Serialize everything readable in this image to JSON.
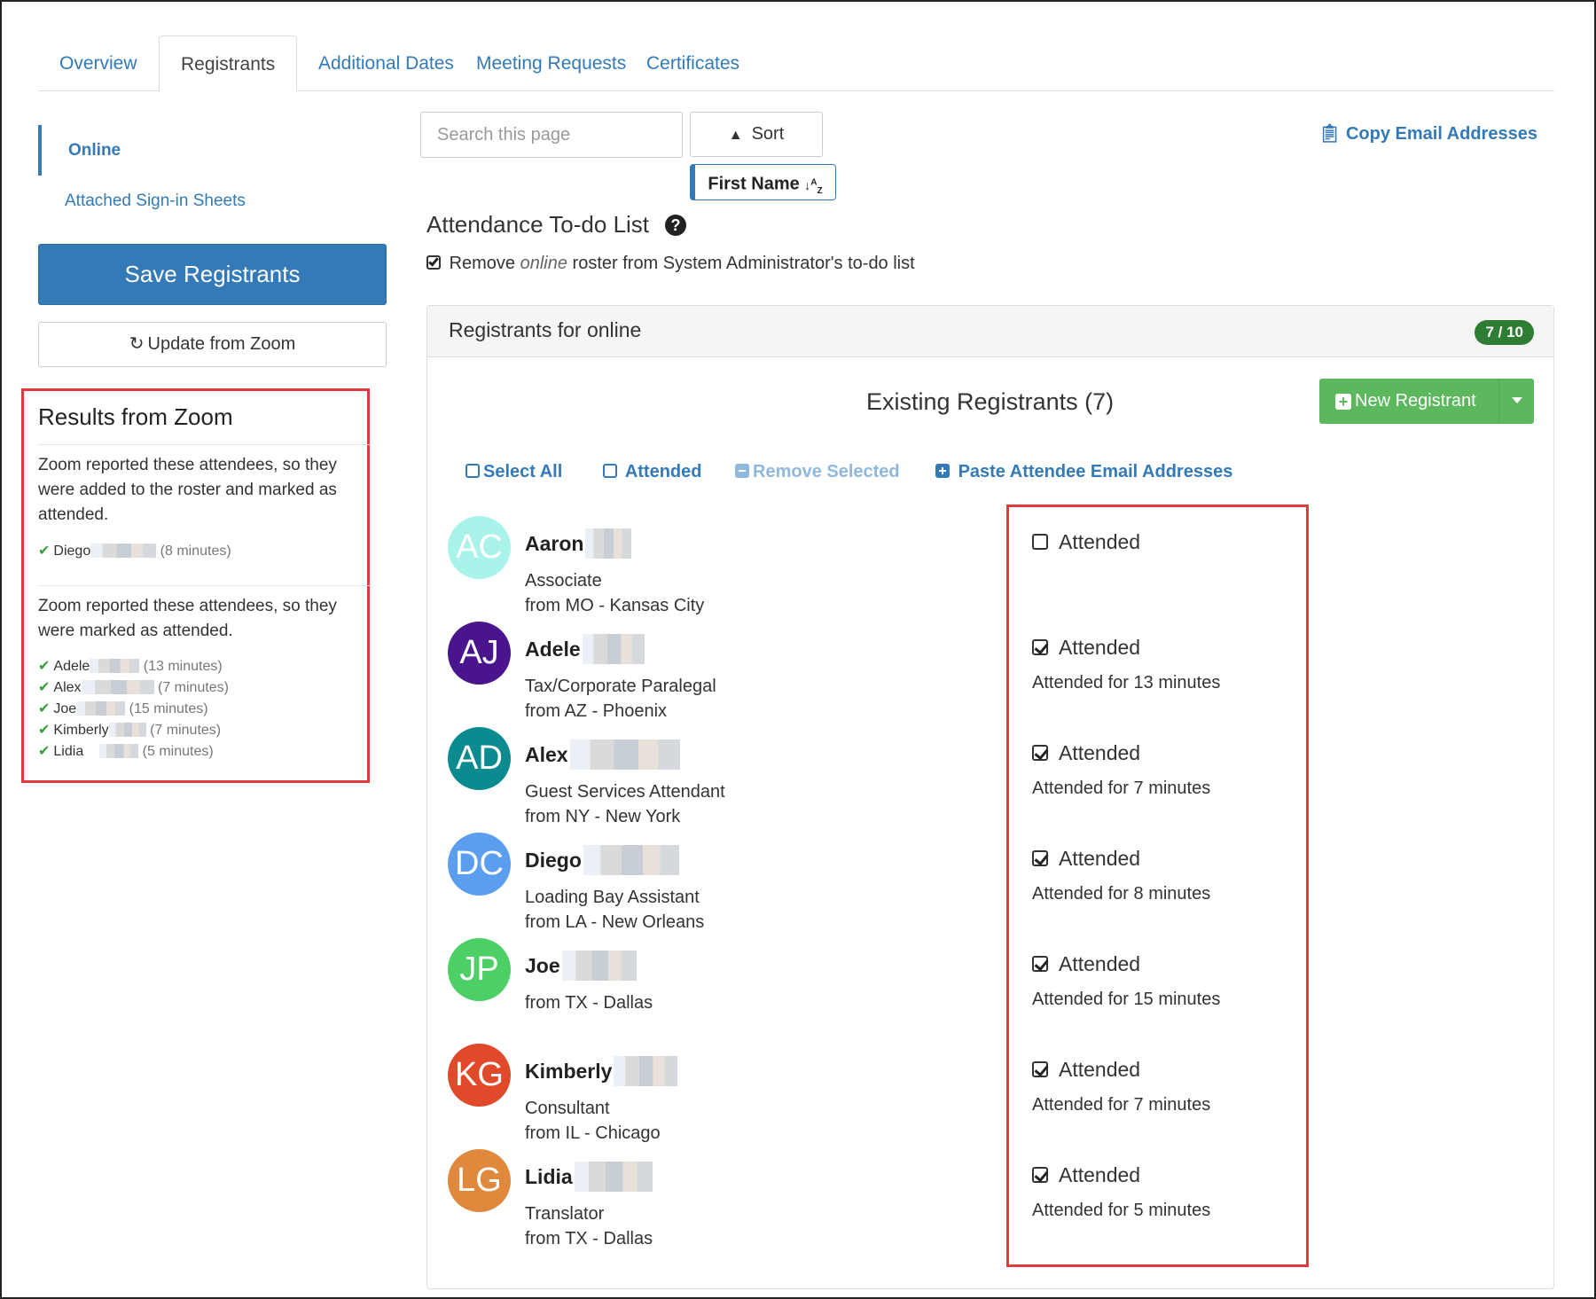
{
  "tabs": [
    {
      "label": "Overview",
      "active": false
    },
    {
      "label": "Registrants",
      "active": true
    },
    {
      "label": "Additional Dates",
      "active": false
    },
    {
      "label": "Meeting Requests",
      "active": false
    },
    {
      "label": "Certificates",
      "active": false
    }
  ],
  "sidebar": {
    "online": "Online",
    "sheets": "Attached Sign-in Sheets",
    "save_label": "Save Registrants",
    "zoom_label": "Update from Zoom"
  },
  "zoom_results": {
    "title": "Results from Zoom",
    "added_text": "Zoom reported these attendees, so they were added to the roster and marked as attended.",
    "added": [
      {
        "name": "Diego",
        "minutes": "(8 minutes)"
      }
    ],
    "marked_text": "Zoom reported these attendees, so they were marked as attended.",
    "marked": [
      {
        "name": "Adele",
        "minutes": "(13 minutes)"
      },
      {
        "name": "Alex",
        "minutes": "(7 minutes)"
      },
      {
        "name": "Joe",
        "minutes": "(15 minutes)"
      },
      {
        "name": "Kimberly",
        "minutes": "(7 minutes)"
      },
      {
        "name": "Lidia",
        "minutes": "(5 minutes)"
      }
    ]
  },
  "toolbar": {
    "search_placeholder": "Search this page",
    "sort_label": "Sort",
    "first_name_label": "First Name",
    "copy_email_label": "Copy Email Addresses"
  },
  "todo": {
    "title": "Attendance To-do List",
    "line_before": "Remove ",
    "line_em": "online",
    "line_after": " roster from System Administrator's to-do list"
  },
  "panel": {
    "title": "Registrants for online",
    "badge": "7 / 10",
    "existing_title": "Existing Registrants (7)",
    "new_label": "New Registrant",
    "actions": {
      "select_all": "Select All",
      "attended": "Attended",
      "remove_selected": "Remove Selected",
      "paste_emails": "Paste Attendee Email Addresses"
    }
  },
  "registrants": [
    {
      "initials": "AC",
      "color": "#a9f3ea",
      "name": "Aaron",
      "title": "Associate",
      "location": "from MO - Kansas City",
      "attended": false,
      "attended_label": "Attended",
      "duration": ""
    },
    {
      "initials": "AJ",
      "color": "#4a148c",
      "name": "Adele",
      "title": "Tax/Corporate Paralegal",
      "location": "from AZ - Phoenix",
      "attended": true,
      "attended_label": "Attended",
      "duration": "Attended for 13 minutes"
    },
    {
      "initials": "AD",
      "color": "#0b8a8f",
      "name": "Alex",
      "title": "Guest Services Attendant",
      "location": "from NY - New York",
      "attended": true,
      "attended_label": "Attended",
      "duration": "Attended for 7 minutes"
    },
    {
      "initials": "DC",
      "color": "#5b9ef0",
      "name": "Diego",
      "title": "Loading Bay Assistant",
      "location": "from LA - New Orleans",
      "attended": true,
      "attended_label": "Attended",
      "duration": "Attended for 8 minutes"
    },
    {
      "initials": "JP",
      "color": "#4cd065",
      "name": "Joe",
      "title": "",
      "location": "from TX - Dallas",
      "attended": true,
      "attended_label": "Attended",
      "duration": "Attended for 15 minutes"
    },
    {
      "initials": "KG",
      "color": "#e04a2b",
      "name": "Kimberly",
      "title": "Consultant",
      "location": "from IL - Chicago",
      "attended": true,
      "attended_label": "Attended",
      "duration": "Attended for 7 minutes"
    },
    {
      "initials": "LG",
      "color": "#e0893c",
      "name": "Lidia",
      "title": "Translator",
      "location": "from TX - Dallas",
      "attended": true,
      "attended_label": "Attended",
      "duration": "Attended for 5 minutes"
    }
  ]
}
